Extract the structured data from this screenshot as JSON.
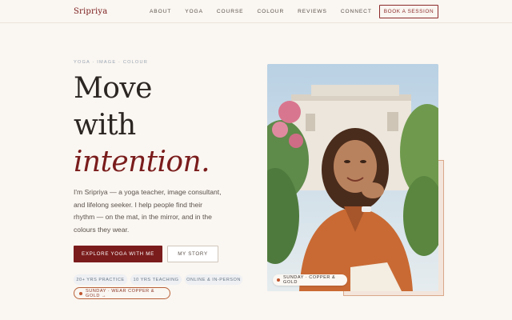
{
  "header": {
    "brand": "Sripriya",
    "nav": [
      "ABOUT",
      "YOGA",
      "COURSE",
      "COLOUR",
      "REVIEWS",
      "CONNECT"
    ],
    "book_label": "BOOK A SESSION"
  },
  "hero": {
    "eyebrow": "YOGA · IMAGE · COLOUR",
    "headline_line1": "Move",
    "headline_line2": "with",
    "headline_accent": "intention.",
    "intro": "I'm Sripriya — a yoga teacher, image consultant, and lifelong seeker. I help people find their rhythm — on the mat, in the mirror, and in the colours they wear.",
    "primary_cta": "EXPLORE YOGA WITH ME",
    "secondary_cta": "MY STORY",
    "chips": [
      "20+ YRS PRACTICE",
      "10 YRS TEACHING",
      "ONLINE & IN-PERSON"
    ],
    "sunday_pill": "SUNDAY · WEAR COPPER & GOLD →"
  },
  "photo": {
    "badge": "SUNDAY · COPPER & GOLD"
  },
  "colors": {
    "brand": "#7a1c1c",
    "background": "#faf6f1",
    "accent_copper": "#c0552e"
  }
}
